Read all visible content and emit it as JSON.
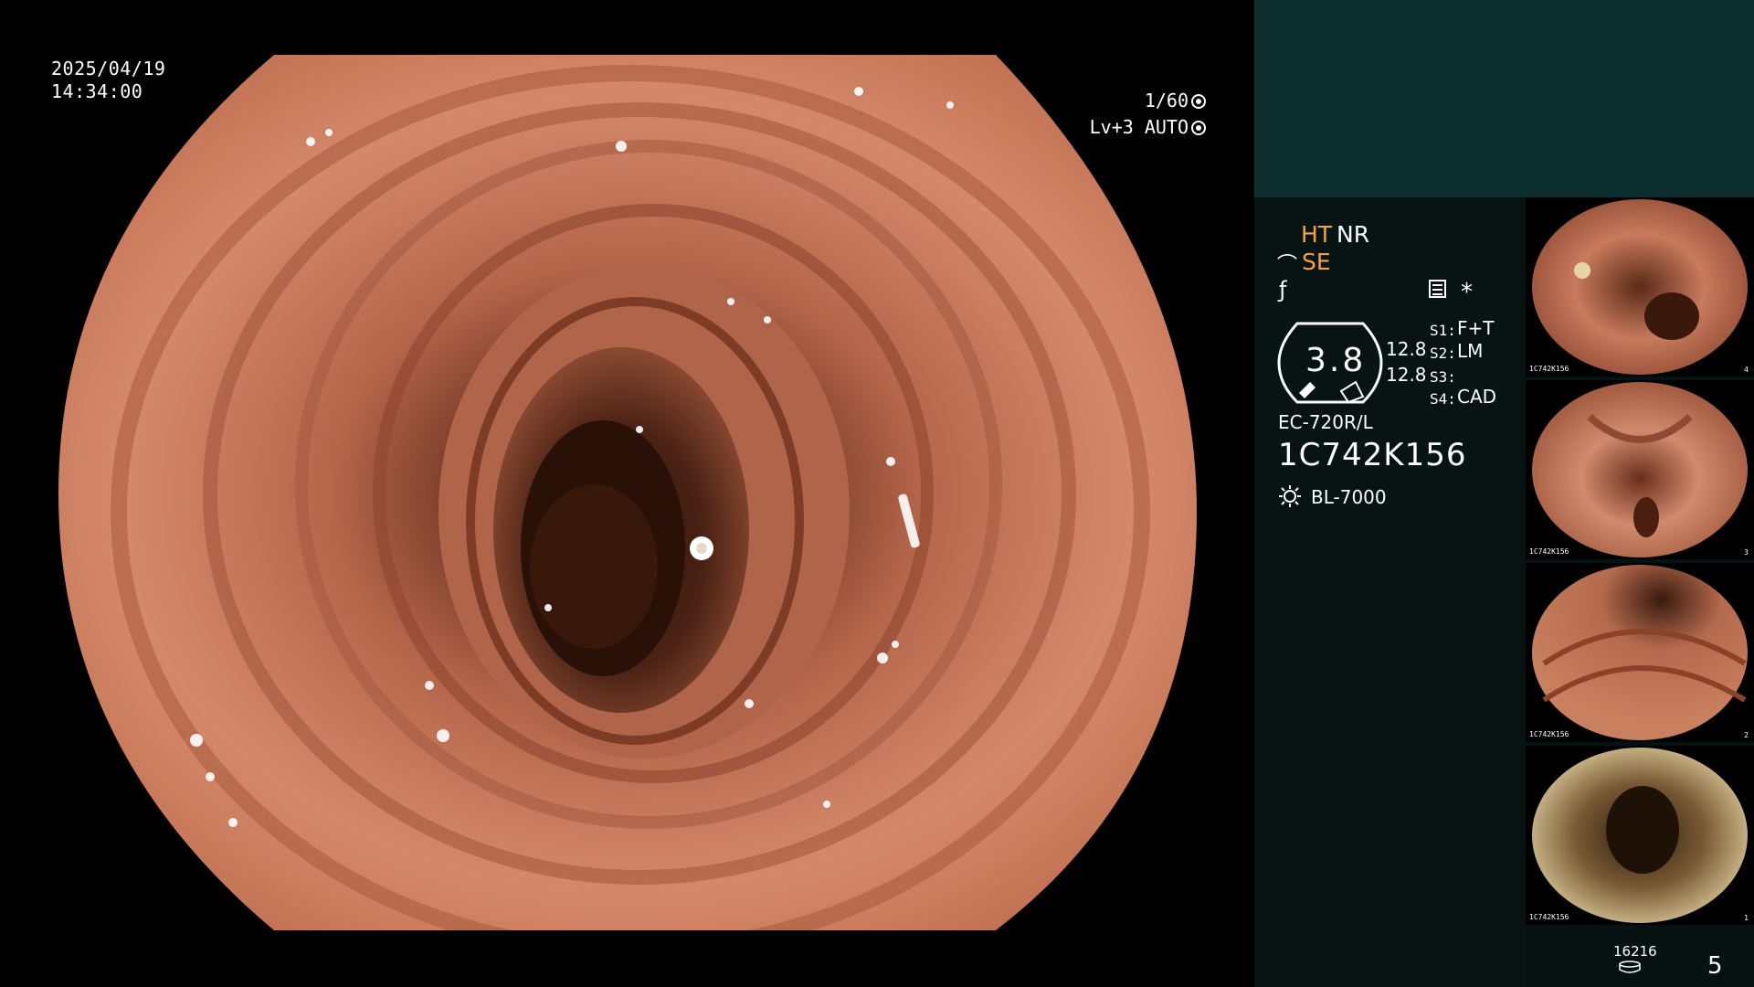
{
  "osd": {
    "date": "2025/04/19",
    "time": "14:34:00",
    "shutter": "1/60",
    "level": "Lv+3 AUTO"
  },
  "panel": {
    "ht": "HT",
    "nr": "NR",
    "se": "SE",
    "star": "*",
    "gauge_value": "3.8",
    "gauge_side_1": "12.8",
    "gauge_side_2": "12.8",
    "settings": [
      {
        "label": "S1:",
        "value": "F+T"
      },
      {
        "label": "S2:",
        "value": "LM"
      },
      {
        "label": "S3:",
        "value": ""
      },
      {
        "label": "S4:",
        "value": "CAD"
      }
    ],
    "scope_model": "EC-720R/L",
    "serial": "1C742K156",
    "light_source": "BL-7000",
    "image_counter": "16216",
    "page_number": "5"
  },
  "thumbnails": [
    {
      "caption": "1C742K156",
      "index": "4"
    },
    {
      "caption": "1C742K156",
      "index": "3"
    },
    {
      "caption": "1C742K156",
      "index": "2"
    },
    {
      "caption": "1C742K156",
      "index": "1"
    }
  ],
  "colors": {
    "orange_label": "#f2a43a",
    "panel_top": "#0d2f2e",
    "panel_bg": "#081413"
  }
}
